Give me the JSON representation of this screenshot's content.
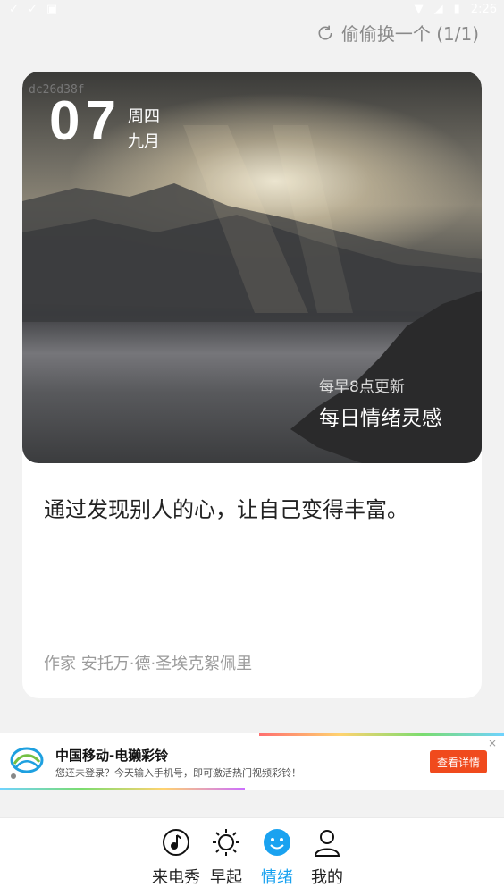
{
  "status_bar": {
    "time": "2:26"
  },
  "header": {
    "swap_label": "偷偷换一个 (1/1)"
  },
  "card": {
    "code": "dc26d38f",
    "day": "07",
    "weekday": "周四",
    "month": "九月",
    "update_hint": "每早8点更新",
    "inspiration_title": "每日情绪灵感",
    "quote": "通过发现别人的心，让自己变得丰富。",
    "author": "作家 安托万·德·圣埃克絮佩里"
  },
  "ad": {
    "title": "中国移动-电獭彩铃",
    "description": "您还未登录？今天输入手机号，即可激活热门视频彩铃！",
    "button": "查看详情",
    "close": "×"
  },
  "tabs": [
    {
      "label": "来电秀",
      "icon": "music-note-icon"
    },
    {
      "label": "早起",
      "icon": "sun-icon"
    },
    {
      "label": "情绪",
      "icon": "smiley-icon",
      "active": true
    },
    {
      "label": "我的",
      "icon": "user-icon"
    }
  ],
  "colors": {
    "accent": "#1aa2f0",
    "ad_button": "#f04a1d"
  }
}
